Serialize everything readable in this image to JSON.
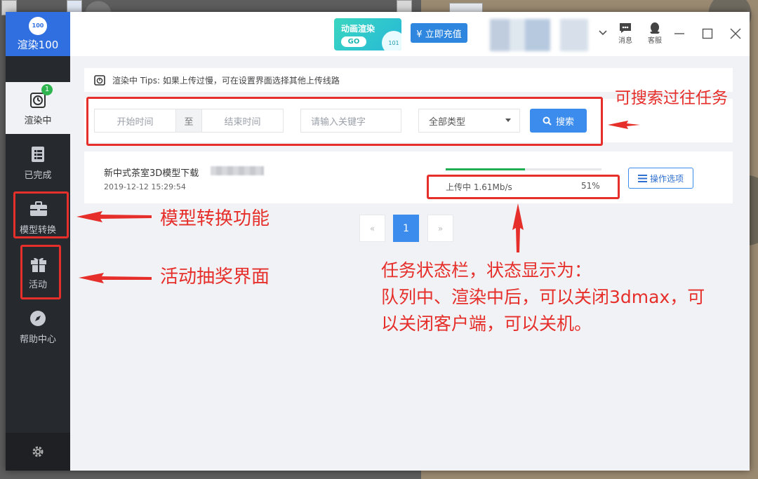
{
  "app": {
    "logo_text": "100",
    "name": "渲染100"
  },
  "sidebar": {
    "items": [
      {
        "label": "渲染中",
        "badge": "1"
      },
      {
        "label": "已完成"
      },
      {
        "label": "模型转换"
      },
      {
        "label": "活动"
      },
      {
        "label": "帮助中心"
      }
    ]
  },
  "topbar": {
    "promo_title": "动画渲染",
    "promo_go": "GO",
    "promo_num": "101",
    "recharge_label": "¥ 立即充值",
    "messages_label": "消息",
    "service_label": "客服"
  },
  "tips": {
    "text": "渲染中 Tips: 如果上传过慢，可在设置界面选择其他上传线路"
  },
  "filter": {
    "start_placeholder": "开始时间",
    "separator": "至",
    "end_placeholder": "结束时间",
    "keyword_placeholder": "请输入关键字",
    "type_value": "全部类型",
    "search_label": "搜索"
  },
  "task": {
    "name": "新中式茶室3D模型下载",
    "time": "2019-12-12 15:29:54",
    "status": "上传中  1.61Mb/s",
    "percent_label": "51%",
    "progress": 0.51,
    "ops_label": "操作选项"
  },
  "pagination": {
    "prev": "«",
    "current": "1",
    "next": "»"
  },
  "annotations": {
    "search": "可搜索过往任务",
    "convert": "模型转换功能",
    "activity": "活动抽奖界面",
    "status_line1": "任务状态栏，状态显示为：",
    "status_line2": "队列中、渲染中后，可以关闭3dmax，可",
    "status_line3": "以关闭客户端，可以关机。"
  },
  "colors": {
    "annotation_red": "#e62e2a",
    "accent_blue": "#3b8ced",
    "sidebar_bg": "#26292e",
    "progress_green": "#1fae52"
  }
}
